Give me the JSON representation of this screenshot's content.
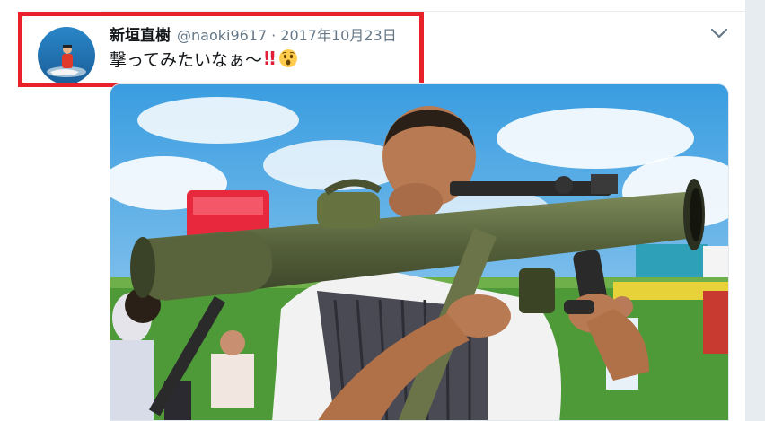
{
  "tweet": {
    "display_name": "新垣直樹",
    "handle": "@naoki9617",
    "separator": "·",
    "date": "2017年10月23日",
    "text": "撃ってみたいなぁ〜",
    "emphasis": "‼",
    "emoji": "astonished-face"
  },
  "colors": {
    "highlight_border": "#e8202a",
    "primary_text": "#14171a",
    "secondary_text": "#657786"
  },
  "media": {
    "subject": "man-aiming-recoilless-rifle-at-outdoor-event"
  }
}
